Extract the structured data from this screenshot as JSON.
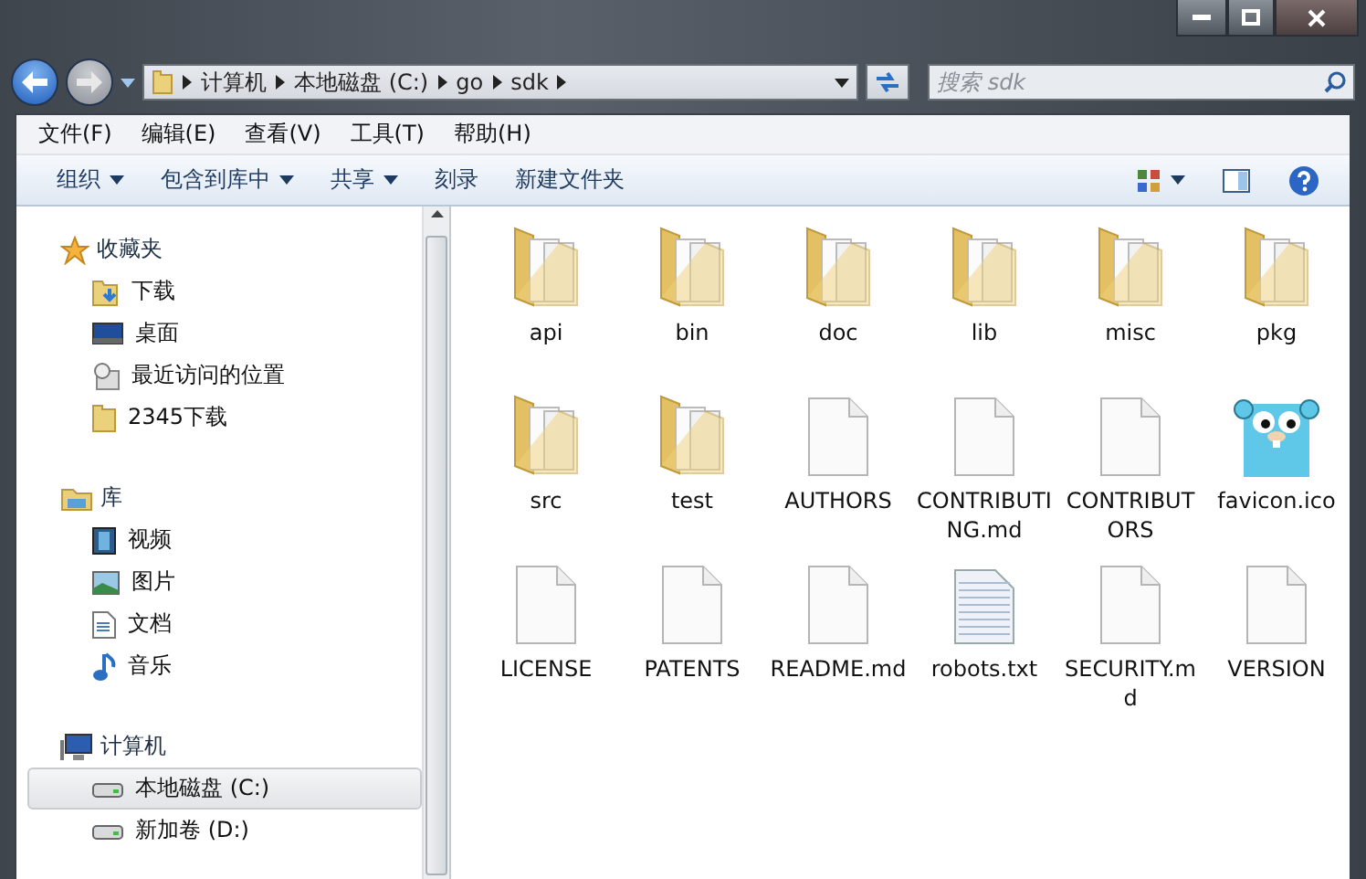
{
  "address_bar": {
    "crumbs": [
      "计算机",
      "本地磁盘 (C:)",
      "go",
      "sdk"
    ]
  },
  "search": {
    "placeholder": "搜索 sdk"
  },
  "menu_bar": [
    "文件(F)",
    "编辑(E)",
    "查看(V)",
    "工具(T)",
    "帮助(H)"
  ],
  "toolbar": [
    {
      "label": "组织",
      "dropdown": true
    },
    {
      "label": "包含到库中",
      "dropdown": true
    },
    {
      "label": "共享",
      "dropdown": true
    },
    {
      "label": "刻录",
      "dropdown": false
    },
    {
      "label": "新建文件夹",
      "dropdown": false
    }
  ],
  "sidebar": {
    "groups": [
      {
        "label": "收藏夹",
        "kind": "favorites",
        "items": [
          {
            "label": "下载",
            "kind": "download",
            "selected": false
          },
          {
            "label": "桌面",
            "kind": "desktop",
            "selected": false
          },
          {
            "label": "最近访问的位置",
            "kind": "recent",
            "selected": false
          },
          {
            "label": "2345下载",
            "kind": "folder",
            "selected": false
          }
        ]
      },
      {
        "label": "库",
        "kind": "library",
        "items": [
          {
            "label": "视频",
            "kind": "video",
            "selected": false
          },
          {
            "label": "图片",
            "kind": "picture",
            "selected": false
          },
          {
            "label": "文档",
            "kind": "document",
            "selected": false
          },
          {
            "label": "音乐",
            "kind": "music",
            "selected": false
          }
        ]
      },
      {
        "label": "计算机",
        "kind": "computer",
        "items": [
          {
            "label": "本地磁盘 (C:)",
            "kind": "drive",
            "selected": true
          },
          {
            "label": "新加卷 (D:)",
            "kind": "drive",
            "selected": false
          }
        ]
      }
    ]
  },
  "files": [
    {
      "name": "api",
      "kind": "folder"
    },
    {
      "name": "bin",
      "kind": "folder"
    },
    {
      "name": "doc",
      "kind": "folder"
    },
    {
      "name": "lib",
      "kind": "folder"
    },
    {
      "name": "misc",
      "kind": "folder"
    },
    {
      "name": "pkg",
      "kind": "folder"
    },
    {
      "name": "src",
      "kind": "folder"
    },
    {
      "name": "test",
      "kind": "folder"
    },
    {
      "name": "AUTHORS",
      "kind": "file"
    },
    {
      "name": "CONTRIBUTING.md",
      "kind": "file"
    },
    {
      "name": "CONTRIBUTORS",
      "kind": "file"
    },
    {
      "name": "favicon.ico",
      "kind": "image"
    },
    {
      "name": "LICENSE",
      "kind": "file"
    },
    {
      "name": "PATENTS",
      "kind": "file"
    },
    {
      "name": "README.md",
      "kind": "file"
    },
    {
      "name": "robots.txt",
      "kind": "text"
    },
    {
      "name": "SECURITY.md",
      "kind": "file"
    },
    {
      "name": "VERSION",
      "kind": "file"
    }
  ]
}
